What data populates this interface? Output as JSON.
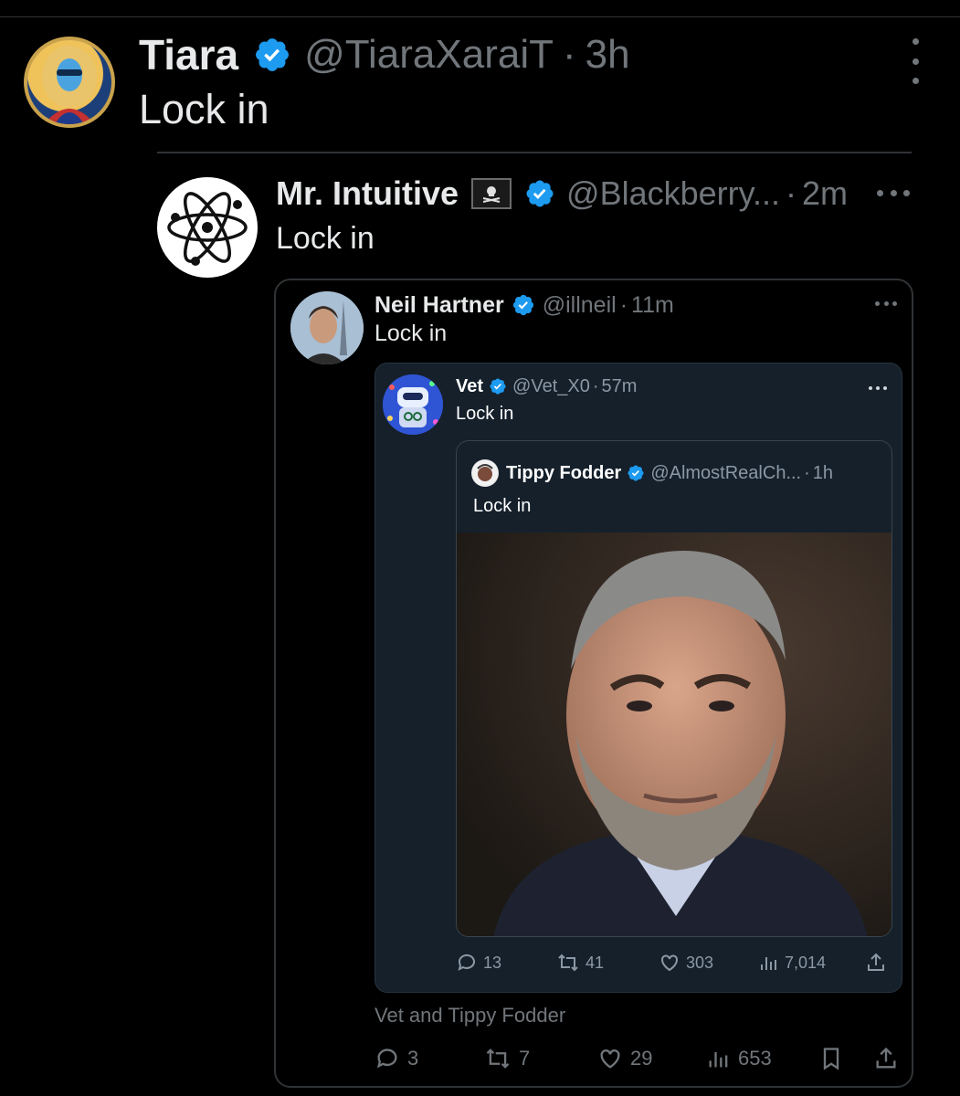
{
  "colors": {
    "background": "#000000",
    "verified_blue": "#1d9bf0",
    "text_primary": "#e7e9ea",
    "text_secondary": "#71767b",
    "quoted_card_bg": "#15202b"
  },
  "tweet": {
    "author": {
      "name": "Tiara",
      "handle": "@TiaraXaraiT",
      "avatar": "tiara-avatar",
      "verified": true
    },
    "separator": "·",
    "time": "3h",
    "text": "Lock in",
    "more_icon": "vertical-ellipsis-icon",
    "reply": {
      "author": {
        "name": "Mr. Intuitive",
        "emoji": "pirate-flag-icon",
        "handle": "@Blackberry...",
        "avatar": "atom-avatar",
        "verified": true
      },
      "separator": "·",
      "time": "2m",
      "text": "Lock in",
      "more_icon": "horizontal-ellipsis-icon",
      "quote": {
        "author": {
          "name": "Neil Hartner",
          "handle": "@illneil",
          "avatar": "neil-avatar",
          "verified": true
        },
        "separator": "·",
        "time": "11m",
        "text": "Lock in",
        "footer": "Vet and Tippy Fodder",
        "stats": {
          "replies": "3",
          "reposts": "7",
          "likes": "29",
          "views": "653"
        },
        "quote": {
          "author": {
            "name": "Vet",
            "handle": "@Vet_X0",
            "avatar": "robot-avatar",
            "verified": true
          },
          "separator": "·",
          "time": "57m",
          "text": "Lock in",
          "stats": {
            "replies": "13",
            "reposts": "41",
            "likes": "303",
            "views": "7,014"
          },
          "quote": {
            "author": {
              "name": "Tippy Fodder",
              "handle": "@AlmostRealCh...",
              "avatar": "tippy-avatar",
              "verified": true
            },
            "separator": "·",
            "time": "1h",
            "text": "Lock in",
            "media": "portrait-photo"
          }
        }
      }
    }
  }
}
